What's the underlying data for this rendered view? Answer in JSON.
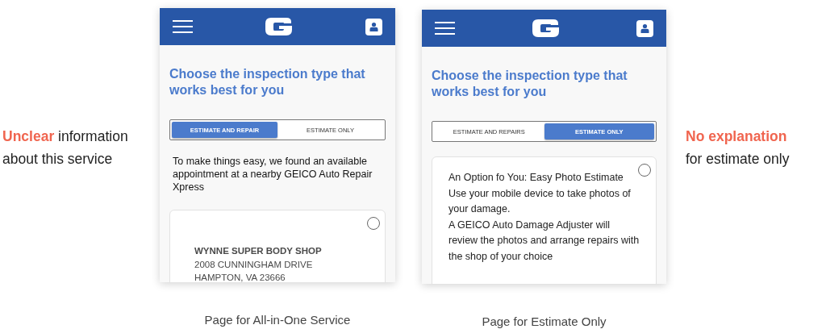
{
  "notes": [
    {
      "text": "**Unclear** information about this service"
    },
    {
      "text": "**No explanation** for estimate only"
    }
  ],
  "screens": [
    {
      "heading": "Choose the inspection type that works best  for you",
      "tabs": [
        {
          "label": "ESTIMATE AND REPAIR",
          "selected": true
        },
        {
          "label": "ESTIMATE ONLY",
          "selected": false
        }
      ],
      "intro": "To make things easy, we found an available appointment at a nearby GEICO Auto Repair Xpress",
      "card": {
        "selected": false,
        "lines": [
          {
            "kind": "title",
            "text": "WYNNE SUPER BODY SHOP"
          },
          {
            "kind": "address",
            "text": "2008 CUNNINGHAM DRIVE"
          },
          {
            "kind": "address",
            "text": "HAMPTON, VA 23666"
          }
        ]
      },
      "caption": "Page for All-in-One Service"
    },
    {
      "heading": "Choose the inspection type that works best  for you",
      "tabs": [
        {
          "label": "ESTIMATE AND REPAIRS",
          "selected": false
        },
        {
          "label": "ESTIMATE ONLY",
          "selected": true
        }
      ],
      "card": {
        "selected": false,
        "lines": [
          {
            "kind": "body",
            "text": "An Option fo You: Easy Photo Estimate"
          },
          {
            "kind": "body",
            "text": "Use your mobile device to take photos of your damage."
          },
          {
            "kind": "body",
            "text": "A GEICO Auto Damage Adjuster will review the photos and arrange repairs with the shop of your choice"
          }
        ]
      },
      "caption": "Page for Estimate Only"
    }
  ]
}
